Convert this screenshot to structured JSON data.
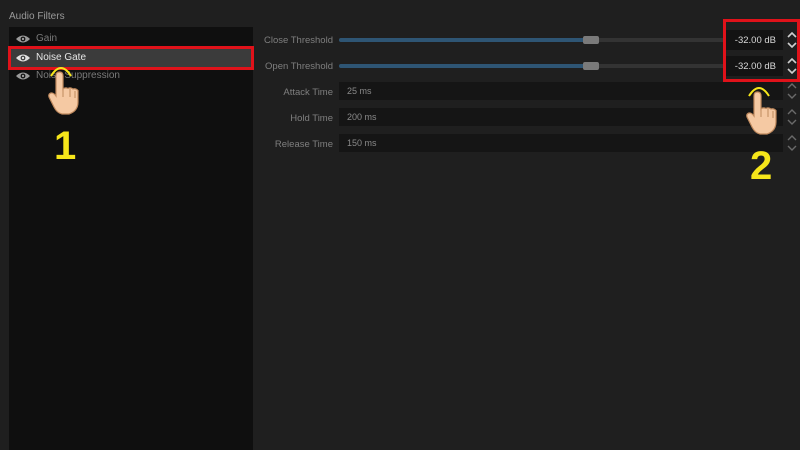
{
  "window": {
    "title": "Audio Filters"
  },
  "filters": [
    {
      "name": "Gain",
      "visible_icon": "eye-icon"
    },
    {
      "name": "Noise Gate",
      "visible_icon": "eye-icon",
      "selected": true
    },
    {
      "name": "Noise Suppression",
      "visible_icon": "eye-icon"
    }
  ],
  "properties": {
    "close_threshold": {
      "label": "Close Threshold",
      "value": "-32.00 dB"
    },
    "open_threshold": {
      "label": "Open Threshold",
      "value": "-32.00 dB"
    },
    "attack_time": {
      "label": "Attack Time",
      "value": "25 ms"
    },
    "hold_time": {
      "label": "Hold Time",
      "value": "200 ms"
    },
    "release_time": {
      "label": "Release Time",
      "value": "150 ms"
    }
  },
  "annotations": {
    "step1": "1",
    "step2": "2"
  },
  "colors": {
    "highlight": "#e0121a",
    "step_number": "#f6e61a",
    "slider_fill": "#2e5574"
  }
}
